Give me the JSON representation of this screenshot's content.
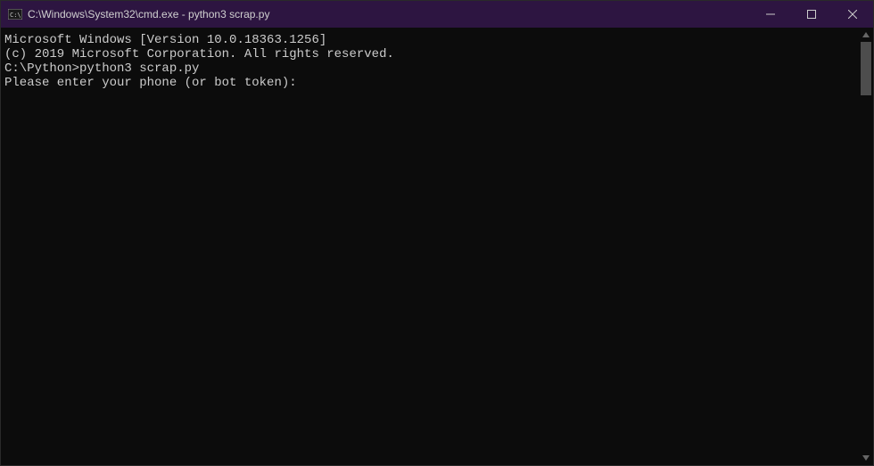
{
  "titlebar": {
    "title": "C:\\Windows\\System32\\cmd.exe - python3  scrap.py"
  },
  "terminal": {
    "line1": "Microsoft Windows [Version 10.0.18363.1256]",
    "line2": "(c) 2019 Microsoft Corporation. All rights reserved.",
    "blank1": "",
    "prompt_path": "C:\\Python>",
    "prompt_cmd": "python3 scrap.py",
    "output1": "Please enter your phone (or bot token):"
  }
}
